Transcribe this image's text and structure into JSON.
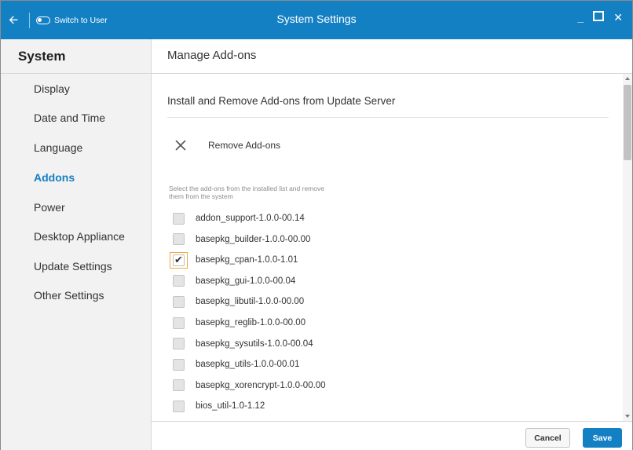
{
  "titlebar": {
    "back_icon": "arrow-left-icon",
    "switch_user_label": "Switch to User",
    "title": "System Settings",
    "minimize_label": "_",
    "close_label": "✕"
  },
  "sidebar": {
    "title": "System",
    "items": [
      {
        "label": "Display",
        "active": false
      },
      {
        "label": "Date and Time",
        "active": false
      },
      {
        "label": "Language",
        "active": false
      },
      {
        "label": "Addons",
        "active": true
      },
      {
        "label": "Power",
        "active": false
      },
      {
        "label": "Desktop Appliance",
        "active": false
      },
      {
        "label": "Update Settings",
        "active": false
      },
      {
        "label": "Other Settings",
        "active": false
      }
    ]
  },
  "main": {
    "page_title": "Manage Add-ons",
    "section_title": "Install and Remove Add-ons from Update Server",
    "remove_label": "Remove Add-ons",
    "help_text": "Select the add-ons from the installed list and remove them from the system",
    "addons": [
      {
        "label": "addon_support-1.0.0-00.14",
        "checked": false
      },
      {
        "label": "basepkg_builder-1.0.0-00.00",
        "checked": false
      },
      {
        "label": "basepkg_cpan-1.0.0-1.01",
        "checked": true
      },
      {
        "label": "basepkg_gui-1.0.0-00.04",
        "checked": false
      },
      {
        "label": "basepkg_libutil-1.0.0-00.00",
        "checked": false
      },
      {
        "label": "basepkg_reglib-1.0.0-00.00",
        "checked": false
      },
      {
        "label": "basepkg_sysutils-1.0.0-00.04",
        "checked": false
      },
      {
        "label": "basepkg_utils-1.0.0-00.01",
        "checked": false
      },
      {
        "label": "basepkg_xorencrypt-1.0.0-00.00",
        "checked": false
      },
      {
        "label": "bios_util-1.0-1.12",
        "checked": false
      }
    ]
  },
  "footer": {
    "cancel_label": "Cancel",
    "save_label": "Save"
  },
  "colors": {
    "accent": "#1480c4",
    "focus_outline": "#f2a93b",
    "sidebar_bg": "#f2f2f2"
  }
}
